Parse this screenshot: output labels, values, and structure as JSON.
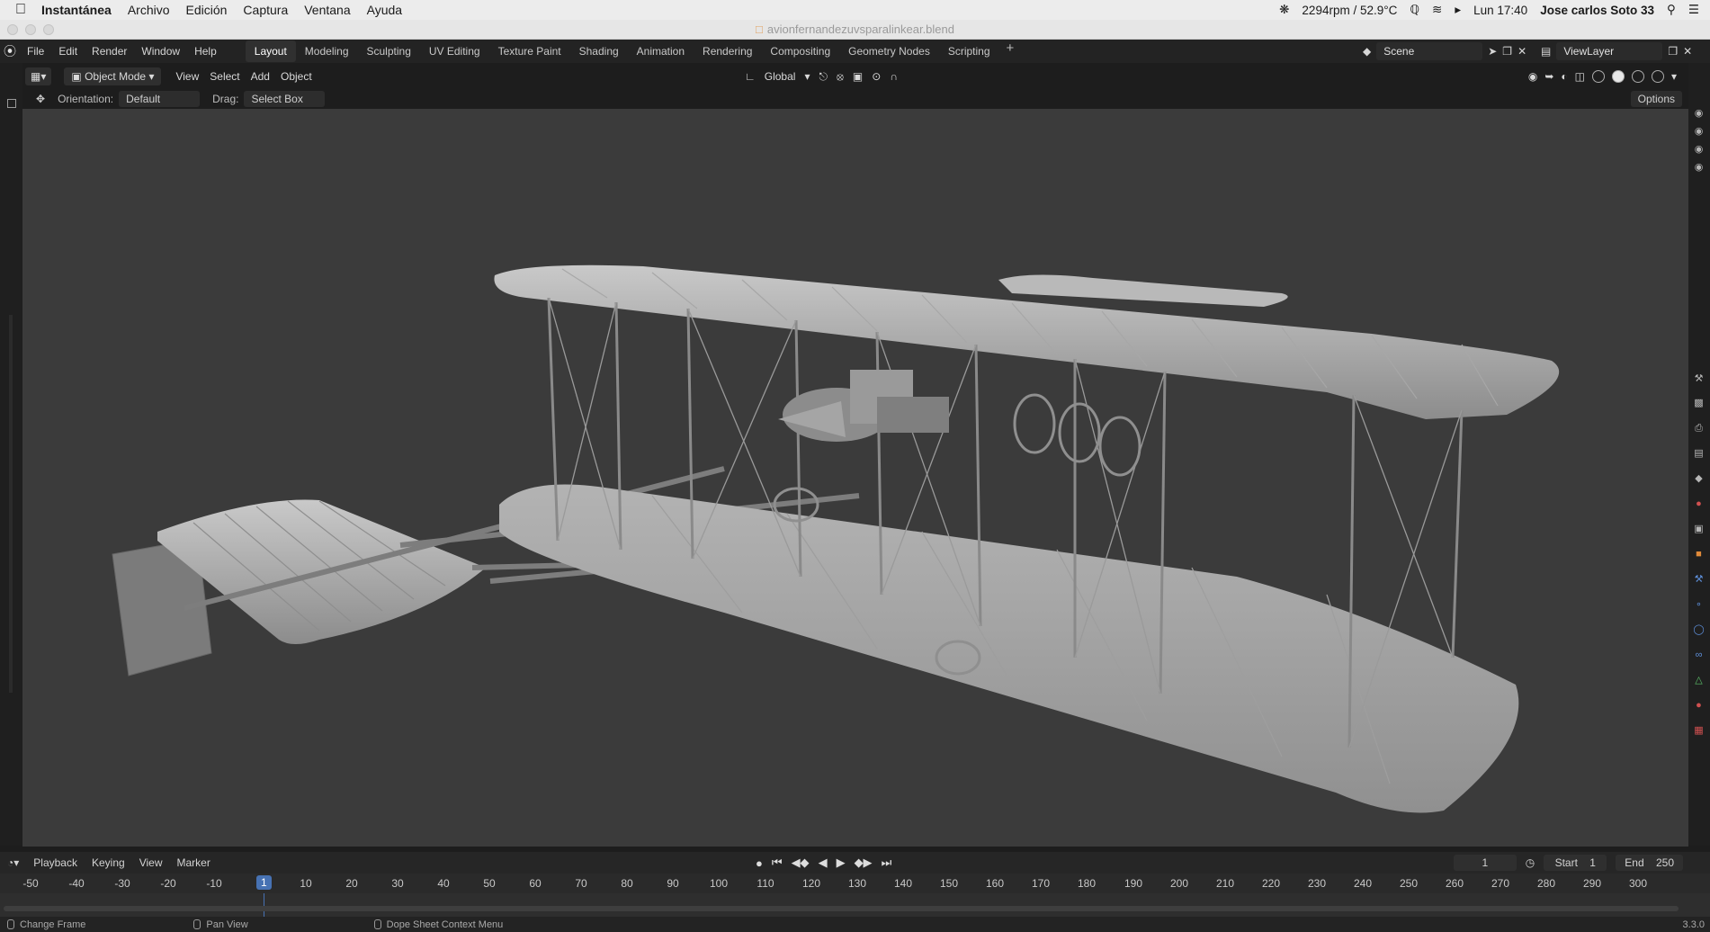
{
  "mac_menubar": {
    "app": "Instantánea",
    "items": [
      "Archivo",
      "Edición",
      "Captura",
      "Ventana",
      "Ayuda"
    ],
    "status": "2294rpm / 52.9°C",
    "clock": "Lun 17:40",
    "user": "Jose carlos Soto 33"
  },
  "window": {
    "title": "avionfernandezuvsparalinkear.blend"
  },
  "topbar": {
    "menus": [
      "File",
      "Edit",
      "Render",
      "Window",
      "Help"
    ],
    "workspaces": [
      "Layout",
      "Modeling",
      "Sculpting",
      "UV Editing",
      "Texture Paint",
      "Shading",
      "Animation",
      "Rendering",
      "Compositing",
      "Geometry Nodes",
      "Scripting"
    ],
    "active_workspace": "Layout",
    "scene": "Scene",
    "view_layer": "ViewLayer"
  },
  "viewport_header": {
    "mode": "Object Mode",
    "menus": [
      "View",
      "Select",
      "Add",
      "Object"
    ],
    "transform": "Global"
  },
  "tool_settings": {
    "orientation_label": "Orientation:",
    "orientation": "Default",
    "drag_label": "Drag:",
    "drag": "Select Box",
    "options": "Options"
  },
  "timeline": {
    "menus": [
      "Playback",
      "Keying",
      "View",
      "Marker"
    ],
    "current_frame": "1",
    "start_label": "Start",
    "start": "1",
    "end_label": "End",
    "end": "250",
    "ruler": [
      "-50",
      "-40",
      "-30",
      "-20",
      "-10",
      "10",
      "20",
      "30",
      "40",
      "50",
      "60",
      "70",
      "80",
      "90",
      "100",
      "110",
      "120",
      "130",
      "140",
      "150",
      "160",
      "170",
      "180",
      "190",
      "200",
      "210",
      "220",
      "230",
      "240",
      "250",
      "260",
      "270",
      "280",
      "290",
      "300"
    ]
  },
  "statusbar": {
    "hints": [
      "Change Frame",
      "Pan View",
      "Dope Sheet Context Menu"
    ],
    "version": "3.3.0"
  }
}
